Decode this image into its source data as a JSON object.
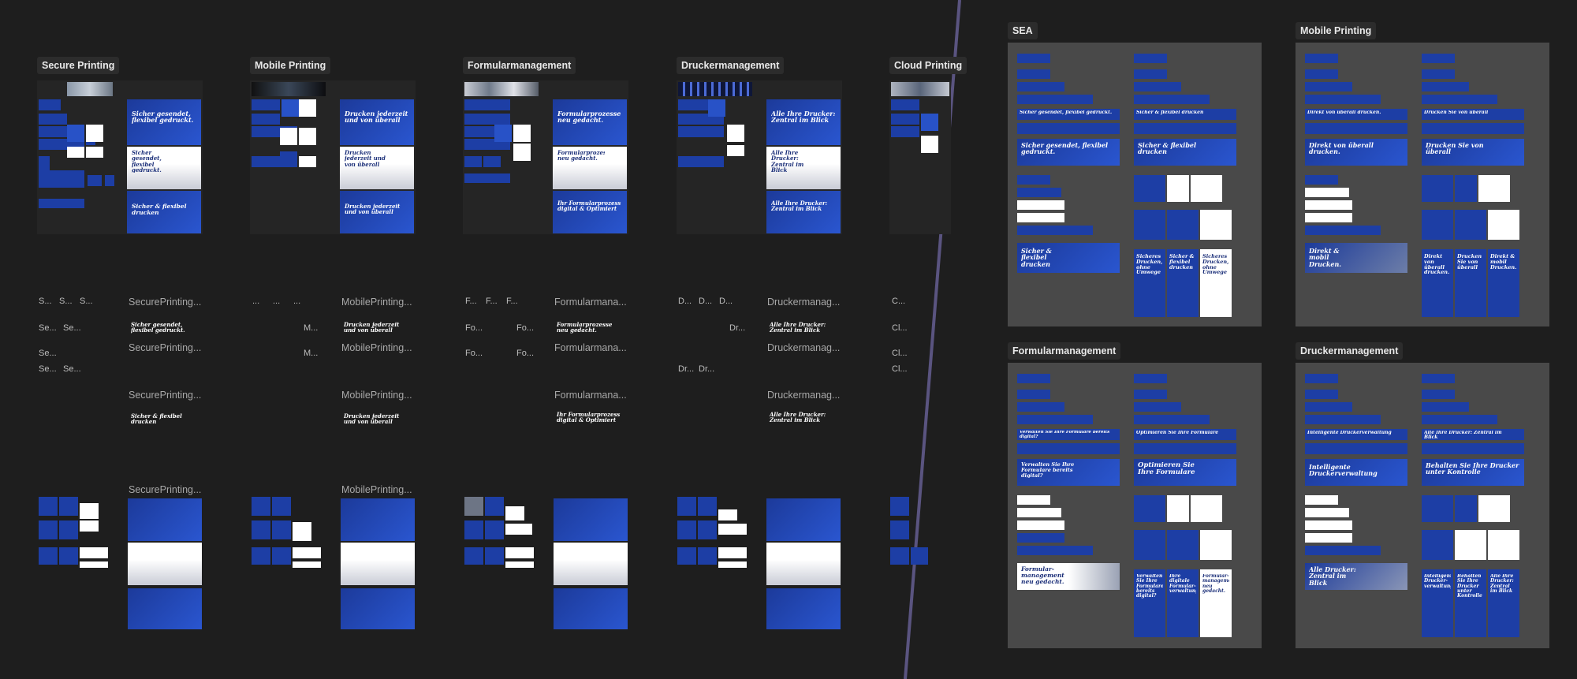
{
  "canvas": {
    "background": "#1e1e1e",
    "divider_color": "#5a5480",
    "panel_color": "#494949"
  },
  "left_boards": {
    "secure": "Secure Printing",
    "mobile": "Mobile Printing",
    "formular": "Formularmanagement",
    "drucker": "Druckermanagement",
    "cloud": "Cloud Printing"
  },
  "ghost_titles": {
    "secure": "SecurePrinting...",
    "mobile": "MobilePrinting...",
    "formular": "Formularmana...",
    "drucker": "Druckermanag...",
    "secure_initial": "S...",
    "mobile_initial": "...",
    "formular_initial": "F...",
    "drucker_initial": "D...",
    "cloud_initial": "C...",
    "secure_short": "Se...",
    "mobile_short": "M...",
    "formular_short": "Fo...",
    "drucker_short": "Dr...",
    "cloud_short": "Cl..."
  },
  "right_panels": {
    "sea": "SEA",
    "mobile": "Mobile Printing",
    "formular": "Formularmanagement",
    "drucker": "Druckermanagement"
  },
  "ad_copy": {
    "secure_1": "Sicher gesendet, flexibel gedruckt.",
    "secure_2": "Sicher & flexibel drucken",
    "secure_3": "Sicher & flexibel drucken",
    "secure_4": "Sicheres Drucken, ohne Umwege",
    "mobile_1": "Drucken jederzeit und von überall",
    "mobile_2": "Direkt von überall drucken.",
    "mobile_3": "Drucken Sie von überall",
    "mobile_4": "Direkt & mobil Drucken.",
    "mobile_5": "Drucken Sie von überall",
    "formular_1": "Formularprozesse neu gedacht.",
    "formular_2": "Ihr Formularprozess digital & Optimiert",
    "formular_3": "Optimieren Sie Ihre Formulare",
    "formular_4": "Verwalten Sie Ihre Formulare bereits digital?",
    "formular_5": "Formular-management neu gedacht.",
    "formular_6": "Ihre digitale Formular-verwaltung",
    "drucker_1": "Alle Ihre Drucker: Zentral im Blick",
    "drucker_2": "Behalten Sie Ihre Drucker unter Kontrolle",
    "drucker_3": "Intelligente Druckerverwaltung",
    "drucker_4": "Alle Drucker: Zentral im Blick",
    "drucker_5": "Intelligente Drucker-verwaltung"
  }
}
